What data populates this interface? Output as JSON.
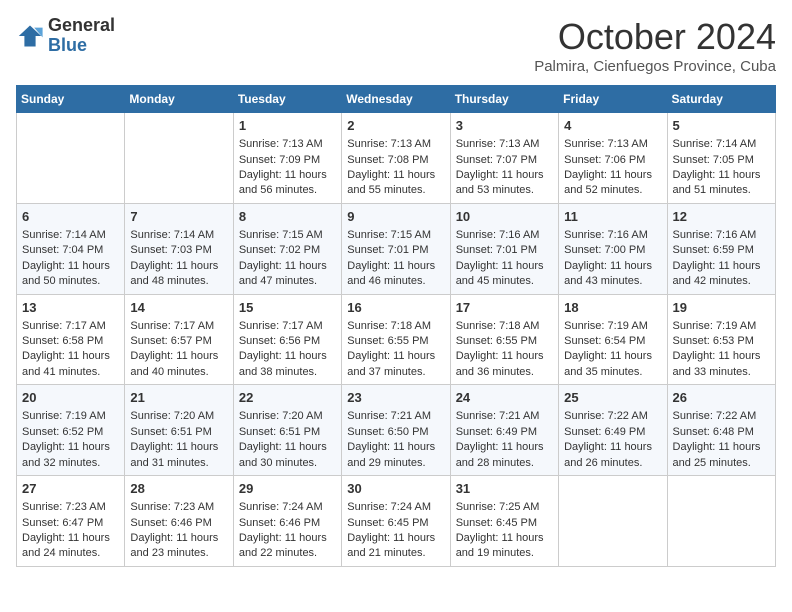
{
  "logo": {
    "general": "General",
    "blue": "Blue"
  },
  "title": "October 2024",
  "location": "Palmira, Cienfuegos Province, Cuba",
  "days_of_week": [
    "Sunday",
    "Monday",
    "Tuesday",
    "Wednesday",
    "Thursday",
    "Friday",
    "Saturday"
  ],
  "weeks": [
    [
      {
        "day": "",
        "info": ""
      },
      {
        "day": "",
        "info": ""
      },
      {
        "day": "1",
        "info": "Sunrise: 7:13 AM\nSunset: 7:09 PM\nDaylight: 11 hours and 56 minutes."
      },
      {
        "day": "2",
        "info": "Sunrise: 7:13 AM\nSunset: 7:08 PM\nDaylight: 11 hours and 55 minutes."
      },
      {
        "day": "3",
        "info": "Sunrise: 7:13 AM\nSunset: 7:07 PM\nDaylight: 11 hours and 53 minutes."
      },
      {
        "day": "4",
        "info": "Sunrise: 7:13 AM\nSunset: 7:06 PM\nDaylight: 11 hours and 52 minutes."
      },
      {
        "day": "5",
        "info": "Sunrise: 7:14 AM\nSunset: 7:05 PM\nDaylight: 11 hours and 51 minutes."
      }
    ],
    [
      {
        "day": "6",
        "info": "Sunrise: 7:14 AM\nSunset: 7:04 PM\nDaylight: 11 hours and 50 minutes."
      },
      {
        "day": "7",
        "info": "Sunrise: 7:14 AM\nSunset: 7:03 PM\nDaylight: 11 hours and 48 minutes."
      },
      {
        "day": "8",
        "info": "Sunrise: 7:15 AM\nSunset: 7:02 PM\nDaylight: 11 hours and 47 minutes."
      },
      {
        "day": "9",
        "info": "Sunrise: 7:15 AM\nSunset: 7:01 PM\nDaylight: 11 hours and 46 minutes."
      },
      {
        "day": "10",
        "info": "Sunrise: 7:16 AM\nSunset: 7:01 PM\nDaylight: 11 hours and 45 minutes."
      },
      {
        "day": "11",
        "info": "Sunrise: 7:16 AM\nSunset: 7:00 PM\nDaylight: 11 hours and 43 minutes."
      },
      {
        "day": "12",
        "info": "Sunrise: 7:16 AM\nSunset: 6:59 PM\nDaylight: 11 hours and 42 minutes."
      }
    ],
    [
      {
        "day": "13",
        "info": "Sunrise: 7:17 AM\nSunset: 6:58 PM\nDaylight: 11 hours and 41 minutes."
      },
      {
        "day": "14",
        "info": "Sunrise: 7:17 AM\nSunset: 6:57 PM\nDaylight: 11 hours and 40 minutes."
      },
      {
        "day": "15",
        "info": "Sunrise: 7:17 AM\nSunset: 6:56 PM\nDaylight: 11 hours and 38 minutes."
      },
      {
        "day": "16",
        "info": "Sunrise: 7:18 AM\nSunset: 6:55 PM\nDaylight: 11 hours and 37 minutes."
      },
      {
        "day": "17",
        "info": "Sunrise: 7:18 AM\nSunset: 6:55 PM\nDaylight: 11 hours and 36 minutes."
      },
      {
        "day": "18",
        "info": "Sunrise: 7:19 AM\nSunset: 6:54 PM\nDaylight: 11 hours and 35 minutes."
      },
      {
        "day": "19",
        "info": "Sunrise: 7:19 AM\nSunset: 6:53 PM\nDaylight: 11 hours and 33 minutes."
      }
    ],
    [
      {
        "day": "20",
        "info": "Sunrise: 7:19 AM\nSunset: 6:52 PM\nDaylight: 11 hours and 32 minutes."
      },
      {
        "day": "21",
        "info": "Sunrise: 7:20 AM\nSunset: 6:51 PM\nDaylight: 11 hours and 31 minutes."
      },
      {
        "day": "22",
        "info": "Sunrise: 7:20 AM\nSunset: 6:51 PM\nDaylight: 11 hours and 30 minutes."
      },
      {
        "day": "23",
        "info": "Sunrise: 7:21 AM\nSunset: 6:50 PM\nDaylight: 11 hours and 29 minutes."
      },
      {
        "day": "24",
        "info": "Sunrise: 7:21 AM\nSunset: 6:49 PM\nDaylight: 11 hours and 28 minutes."
      },
      {
        "day": "25",
        "info": "Sunrise: 7:22 AM\nSunset: 6:49 PM\nDaylight: 11 hours and 26 minutes."
      },
      {
        "day": "26",
        "info": "Sunrise: 7:22 AM\nSunset: 6:48 PM\nDaylight: 11 hours and 25 minutes."
      }
    ],
    [
      {
        "day": "27",
        "info": "Sunrise: 7:23 AM\nSunset: 6:47 PM\nDaylight: 11 hours and 24 minutes."
      },
      {
        "day": "28",
        "info": "Sunrise: 7:23 AM\nSunset: 6:46 PM\nDaylight: 11 hours and 23 minutes."
      },
      {
        "day": "29",
        "info": "Sunrise: 7:24 AM\nSunset: 6:46 PM\nDaylight: 11 hours and 22 minutes."
      },
      {
        "day": "30",
        "info": "Sunrise: 7:24 AM\nSunset: 6:45 PM\nDaylight: 11 hours and 21 minutes."
      },
      {
        "day": "31",
        "info": "Sunrise: 7:25 AM\nSunset: 6:45 PM\nDaylight: 11 hours and 19 minutes."
      },
      {
        "day": "",
        "info": ""
      },
      {
        "day": "",
        "info": ""
      }
    ]
  ]
}
